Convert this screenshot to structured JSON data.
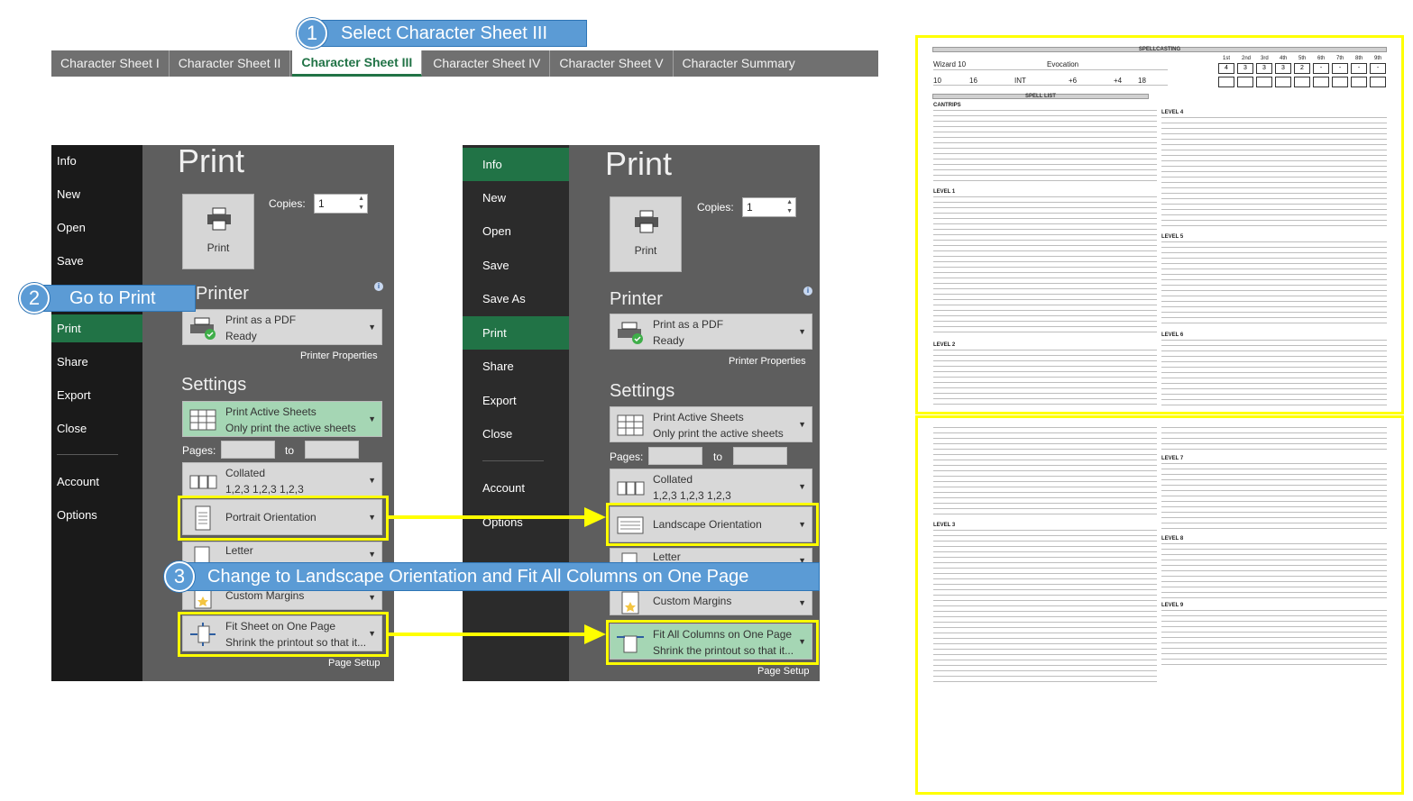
{
  "tabs": [
    "Character Sheet I",
    "Character Sheet II",
    "Character Sheet III",
    "Character Sheet IV",
    "Character Sheet V",
    "Character Summary"
  ],
  "callouts": {
    "c1": {
      "num": "1",
      "text": "Select Character Sheet III"
    },
    "c2": {
      "num": "2",
      "text": "Go to Print"
    },
    "c3": {
      "num": "3",
      "text": "Change to Landscape Orientation and Fit All Columns on One Page"
    }
  },
  "pane1": {
    "nav": [
      "Info",
      "New",
      "Open",
      "Save",
      "Print",
      "Share",
      "Export",
      "Close",
      "Account",
      "Options"
    ],
    "title": "Print",
    "print_btn": "Print",
    "copies_label": "Copies:",
    "copies_value": "1",
    "printer_heading": "Printer",
    "printer_line1": "Print as a PDF",
    "printer_line2": "Ready",
    "printer_props": "Printer Properties",
    "settings_heading": "Settings",
    "active_1": "Print Active Sheets",
    "active_2": "Only print the active sheets",
    "pages_label": "Pages:",
    "to_label": "to",
    "collated_1": "Collated",
    "collated_2": "1,2,3   1,2,3   1,2,3",
    "orientation": "Portrait Orientation",
    "letter": "Letter",
    "margins": "Custom Margins",
    "fit_1": "Fit Sheet on One Page",
    "fit_2": "Shrink the printout so that it...",
    "page_setup": "Page Setup"
  },
  "pane2": {
    "nav": [
      "Info",
      "New",
      "Open",
      "Save",
      "Save As",
      "Print",
      "Share",
      "Export",
      "Close",
      "Account",
      "Options"
    ],
    "title": "Print",
    "print_btn": "Print",
    "copies_label": "Copies:",
    "copies_value": "1",
    "printer_heading": "Printer",
    "printer_line1": "Print as a PDF",
    "printer_line2": "Ready",
    "printer_props": "Printer Properties",
    "settings_heading": "Settings",
    "active_1": "Print Active Sheets",
    "active_2": "Only print the active sheets",
    "pages_label": "Pages:",
    "to_label": "to",
    "collated_1": "Collated",
    "collated_2": "1,2,3   1,2,3   1,2,3",
    "orientation": "Landscape Orientation",
    "letter": "Letter",
    "margins": "Custom Margins",
    "fit_1": "Fit All Columns on One Page",
    "fit_2": "Shrink the printout so that it...",
    "page_setup": "Page Setup"
  },
  "sheet": {
    "spellcasting": "SPELLCASTING",
    "spell_list": "SPELL LIST",
    "class": "Wizard 10",
    "school": "Evocation",
    "spell_ability": "INT",
    "save_dc": "16",
    "attack": "+6",
    "prof": "+4",
    "spells_prepared": "18",
    "level": "10",
    "slot_headers": [
      "1st",
      "2nd",
      "3rd",
      "4th",
      "5th",
      "6th",
      "7th",
      "8th",
      "9th"
    ],
    "slots": [
      "4",
      "3",
      "3",
      "3",
      "2",
      "-",
      "-",
      "-",
      "-"
    ],
    "level_headers": [
      "CANTRIPS",
      "LEVEL 1",
      "LEVEL 2",
      "LEVEL 3",
      "LEVEL 4",
      "LEVEL 5",
      "LEVEL 6",
      "LEVEL 7",
      "LEVEL 8",
      "LEVEL 9"
    ]
  },
  "colors": {
    "accent": "#217346",
    "callout": "#5b9bd5",
    "highlight": "#ffff00"
  }
}
